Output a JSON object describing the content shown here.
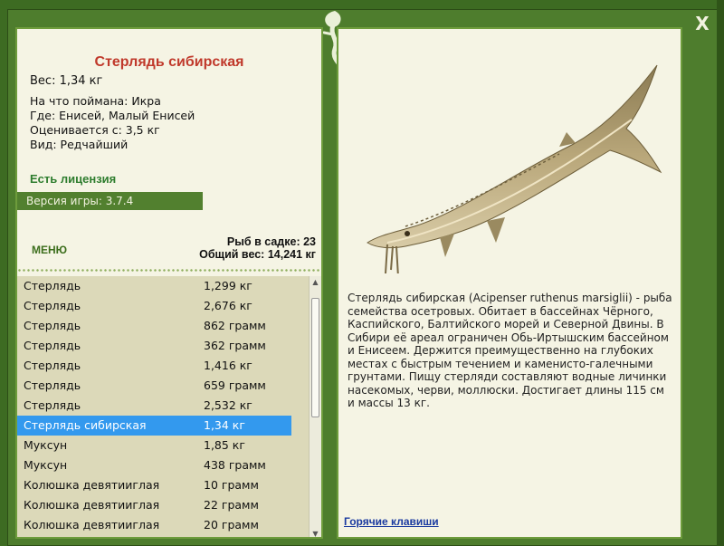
{
  "close_label": "X",
  "fish": {
    "title": "Стерлядь сибирская",
    "weight_line": "Вес: 1,34 кг",
    "info": [
      "На что поймана: Икра",
      "Где: Енисей, Малый Енисей",
      "Оценивается с: 3,5 кг",
      "Вид: Редчайший"
    ],
    "description": "Стерлядь сибирская (Acipenser ruthenus marsiglii) - рыба семейства осетровых. Обитает в бассейнах Чёрного, Каспийского, Балтийского морей и Северной Двины. В Сибири её ареал ограничен Обь-Иртышским бассейном и Енисеем. Держится преимущественно на глубоких местах с быстрым течением и каменисто-галечными грунтами. Пищу стерляди составляют водные личинки насекомых, черви, моллюски. Достигает длины 115 см и массы 13 кг."
  },
  "license_text": "Есть лицензия",
  "version_text": "Версия игры: 3.7.4",
  "menu_label": "МЕНЮ",
  "stats": {
    "count_line": "Рыб в садке: 23",
    "total_line": "Общий вес: 14,241 кг"
  },
  "catch_list": [
    {
      "name": "Стерлядь",
      "weight": "1,299 кг"
    },
    {
      "name": "Стерлядь",
      "weight": "2,676 кг"
    },
    {
      "name": "Стерлядь",
      "weight": "862 грамм"
    },
    {
      "name": "Стерлядь",
      "weight": "362 грамм"
    },
    {
      "name": "Стерлядь",
      "weight": "1,416 кг"
    },
    {
      "name": "Стерлядь",
      "weight": "659 грамм"
    },
    {
      "name": "Стерлядь",
      "weight": "2,532 кг"
    },
    {
      "name": "Стерлядь сибирская",
      "weight": "1,34 кг",
      "selected": true
    },
    {
      "name": "Муксун",
      "weight": "1,85 кг"
    },
    {
      "name": "Муксун",
      "weight": "438 грамм"
    },
    {
      "name": "Колюшка девятииглая",
      "weight": "10 грамм"
    },
    {
      "name": "Колюшка девятииглая",
      "weight": "22 грамм"
    },
    {
      "name": "Колюшка девятииглая",
      "weight": "20 грамм"
    }
  ],
  "hotkeys_label": "Горячие клавиши",
  "colors": {
    "title": "#c0392b",
    "license": "#2e7d2e",
    "selection": "#3399ee",
    "frame": "#4e7d2d"
  }
}
